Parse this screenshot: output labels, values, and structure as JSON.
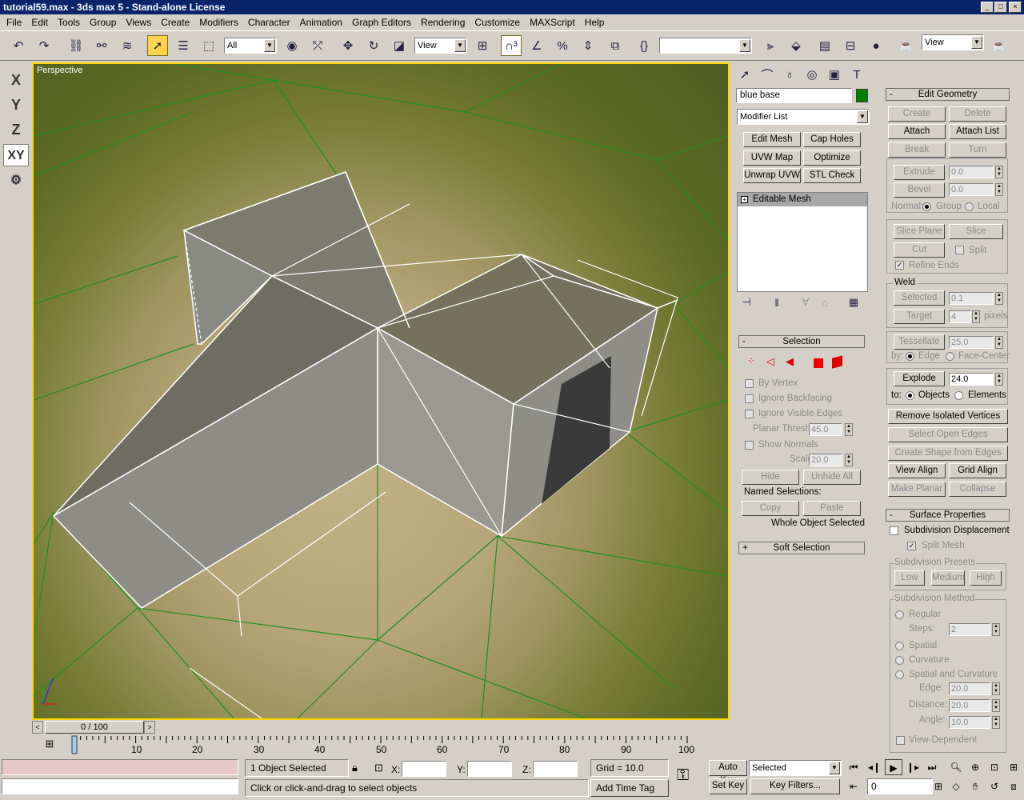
{
  "title": "tutorial59.max - 3ds max 5 - Stand-alone License",
  "menu": [
    "File",
    "Edit",
    "Tools",
    "Group",
    "Views",
    "Create",
    "Modifiers",
    "Character",
    "Animation",
    "Graph Editors",
    "Rendering",
    "Customize",
    "MAXScript",
    "Help"
  ],
  "toolbar": {
    "selection_filter": "All",
    "ref_coord": "View",
    "named_sel": "",
    "view_combo": "View"
  },
  "axis_buttons": [
    "X",
    "Y",
    "Z",
    "XY"
  ],
  "viewport": {
    "label": "Perspective"
  },
  "object": {
    "name": "blue base",
    "color": "#008000"
  },
  "modifier_list": "Modifier List",
  "modifier_buttons": [
    "Edit Mesh",
    "Cap Holes",
    "UVW Map",
    "Optimize",
    "Unwrap UVW",
    "STL Check"
  ],
  "stack": [
    "Editable Mesh"
  ],
  "selection": {
    "title": "Selection",
    "by_vertex": "By Vertex",
    "ignore_backfacing": "Ignore Backfacing",
    "ignore_visible_edges": "Ignore Visible Edges",
    "planar_thresh_label": "Planar Thresh:",
    "planar_thresh": "45.0",
    "show_normals": "Show Normals",
    "scale_label": "Scale:",
    "scale": "20.0",
    "hide": "Hide",
    "unhide_all": "Unhide All",
    "named_selections": "Named Selections:",
    "copy": "Copy",
    "paste": "Paste",
    "status": "Whole Object Selected"
  },
  "soft_selection": "Soft Selection",
  "edit_geometry": {
    "title": "Edit Geometry",
    "create": "Create",
    "delete": "Delete",
    "attach": "Attach",
    "attach_list": "Attach List",
    "break": "Break",
    "turn": "Turn",
    "extrude": "Extrude",
    "extrude_val": "0.0",
    "bevel": "Bevel",
    "bevel_val": "0.0",
    "normal": "Normal:",
    "group": "Group",
    "local": "Local",
    "slice_plane": "Slice Plane",
    "slice": "Slice",
    "cut": "Cut",
    "split": "Split",
    "refine_ends": "Refine Ends",
    "weld": "Weld",
    "selected": "Selected",
    "selected_val": "0.1",
    "target": "Target",
    "target_val": "4",
    "pixels": "pixels",
    "tessellate": "Tessellate",
    "tessellate_val": "25.0",
    "by": "by:",
    "edge": "Edge",
    "face_center": "Face-Center",
    "explode": "Explode",
    "explode_val": "24.0",
    "to": "to:",
    "objects": "Objects",
    "elements": "Elements",
    "remove_isolated": "Remove Isolated Vertices",
    "select_open_edges": "Select Open Edges",
    "create_shape": "Create Shape from Edges",
    "view_align": "View Align",
    "grid_align": "Grid Align",
    "make_planar": "Make Planar",
    "collapse": "Collapse"
  },
  "surface_properties": {
    "title": "Surface Properties",
    "subdivision_displacement": "Subdivision Displacement",
    "split_mesh": "Split Mesh",
    "presets_label": "Subdivision Presets",
    "low": "Low",
    "medium": "Medium",
    "high": "High",
    "method_label": "Subdivision Method",
    "regular": "Regular",
    "steps_label": "Steps:",
    "steps": "2",
    "spatial": "Spatial",
    "curvature": "Curvature",
    "spatial_curvature": "Spatial and Curvature",
    "edge_label": "Edge:",
    "edge_val": "20.0",
    "distance_label": "Distance:",
    "distance_val": "20.0",
    "angle_label": "Angle:",
    "angle_val": "10.0",
    "view_dependent": "View-Dependent"
  },
  "timeline": {
    "frame": "0 / 100",
    "ticks": [
      "0",
      "10",
      "20",
      "30",
      "40",
      "50",
      "60",
      "70",
      "80",
      "90",
      "100"
    ]
  },
  "status": {
    "objects_selected": "1 Object Selected",
    "prompt": "Click or click-and-drag to select objects",
    "x_label": "X:",
    "y_label": "Y:",
    "z_label": "Z:",
    "x": "",
    "y": "",
    "z": "",
    "grid": "Grid = 10.0",
    "add_time_tag": "Add Time Tag",
    "auto_key": "Auto Key",
    "set_key": "Set Key",
    "key_mode": "Selected",
    "key_filters": "Key Filters...",
    "current_frame": "0"
  }
}
